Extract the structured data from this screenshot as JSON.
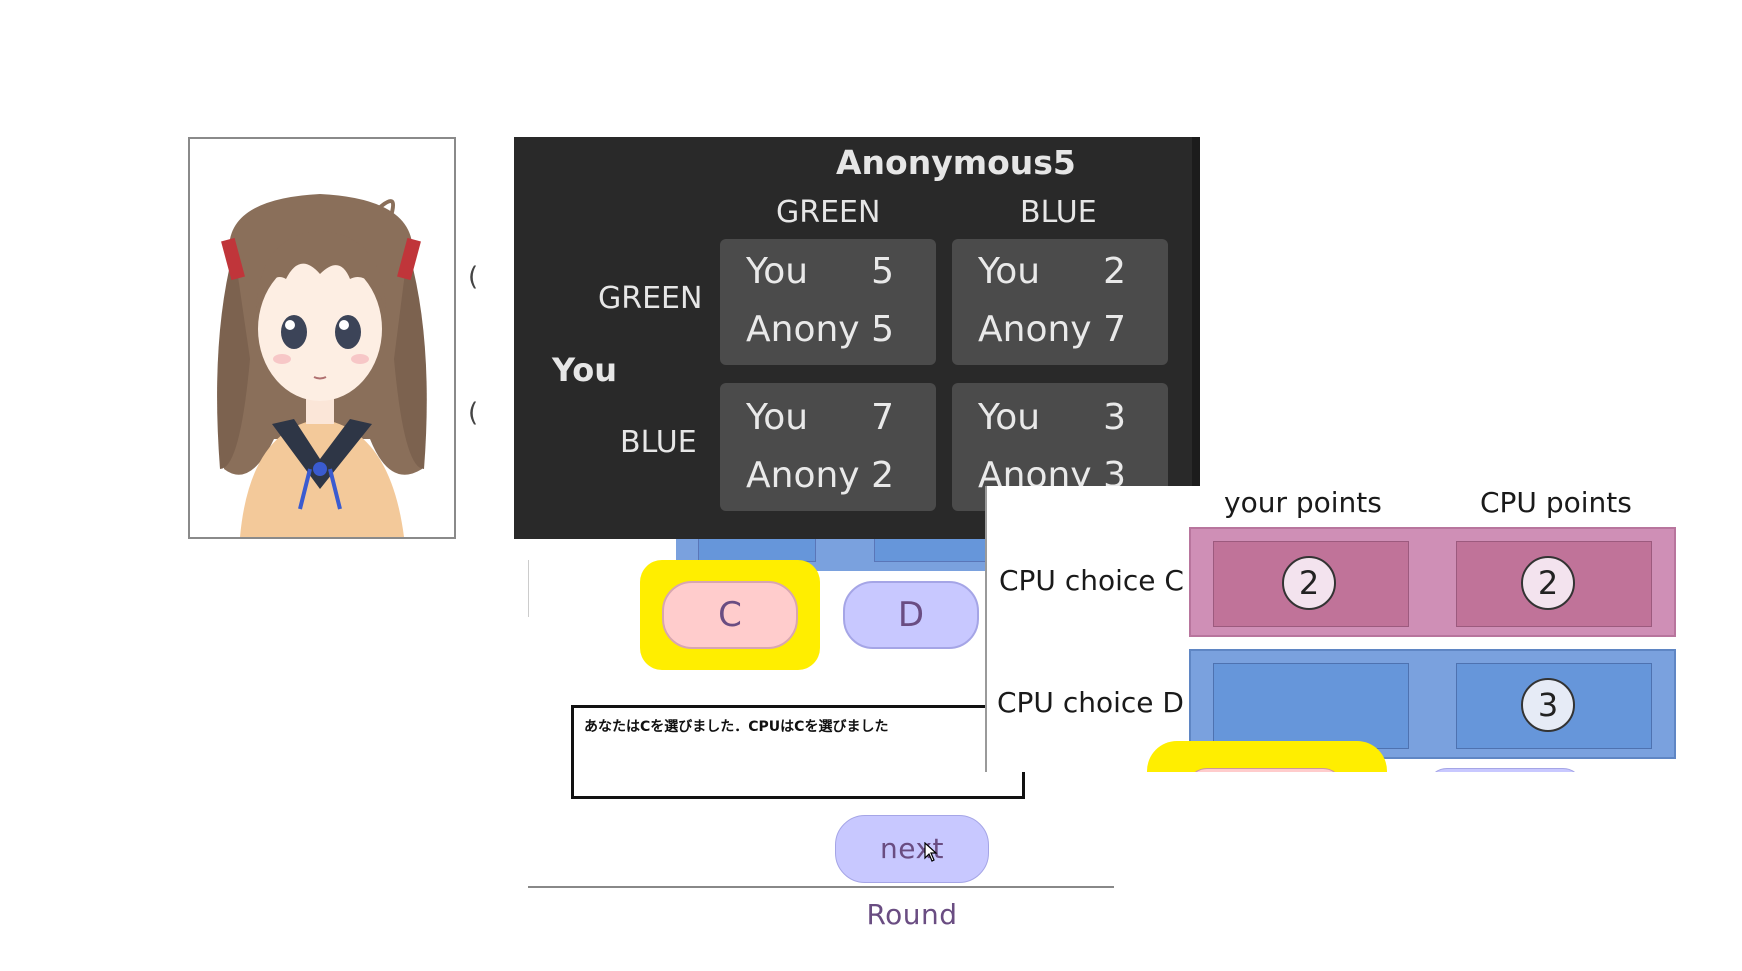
{
  "avatar": {
    "alt": "anime girl avatar",
    "parens": [
      "(",
      "("
    ]
  },
  "matrix": {
    "opponent_name": "Anonymous5",
    "col_headers": [
      "GREEN",
      "BLUE"
    ],
    "row_headers": [
      "GREEN",
      "BLUE"
    ],
    "row_player": "You",
    "cells": [
      [
        {
          "you_label": "You",
          "you": "5",
          "opp_label": "Anony",
          "opp": "5"
        },
        {
          "you_label": "You",
          "you": "2",
          "opp_label": "Anony",
          "opp": "7"
        }
      ],
      [
        {
          "you_label": "You",
          "you": "7",
          "opp_label": "Anony",
          "opp": "2"
        },
        {
          "you_label": "You",
          "you": "3",
          "opp_label": "Anony",
          "opp": "3"
        }
      ]
    ]
  },
  "choices": {
    "c_label": "C",
    "d_label": "D"
  },
  "message": "あなたはCを選びました．CPUはCを選びました",
  "next_round_label": "next Round",
  "points": {
    "col_headers": [
      "your points",
      "CPU points"
    ],
    "rows": [
      {
        "label": "CPU choice C",
        "your": "2",
        "cpu": "2"
      },
      {
        "label": "CPU choice D",
        "your": "",
        "cpu": "3"
      }
    ]
  },
  "colors": {
    "pink_row": "#cf8fb6",
    "pink_cell": "#c07399",
    "blue_row": "#7aa1de",
    "blue_cell": "#6696da",
    "highlight": "#ffee00"
  }
}
